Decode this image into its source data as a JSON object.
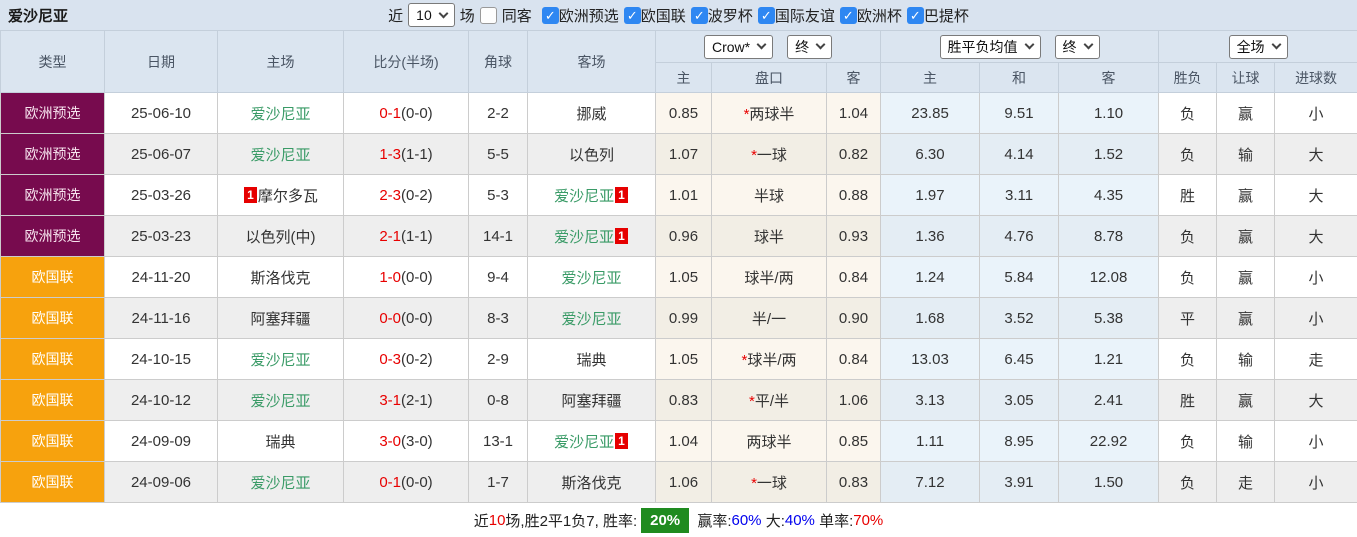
{
  "topbar": {
    "title": "爱沙尼亚",
    "near_label": "近",
    "count_value": "10",
    "games_label": "场",
    "same_visit_label": "同客",
    "same_visit_checked": false,
    "filters": [
      {
        "label": "欧洲预选",
        "checked": true
      },
      {
        "label": "欧国联",
        "checked": true
      },
      {
        "label": "波罗杯",
        "checked": true
      },
      {
        "label": "国际友谊",
        "checked": true
      },
      {
        "label": "欧洲杯",
        "checked": true
      },
      {
        "label": "巴提杯",
        "checked": true
      }
    ]
  },
  "table": {
    "main_headers": [
      "类型",
      "日期",
      "主场",
      "比分(半场)",
      "角球",
      "客场"
    ],
    "selects": {
      "asian_company": "Crow*",
      "asian_time": "终",
      "europe_type": "胜平负均值",
      "europe_time": "终",
      "scope": "全场"
    },
    "sub_headers": [
      "主",
      "盘口",
      "客",
      "主",
      "和",
      "客",
      "胜负",
      "让球",
      "进球数"
    ],
    "rows": [
      {
        "type": "欧洲预选",
        "type_color": "maroon",
        "date": "25-06-10",
        "home": "爱沙尼亚",
        "home_green": true,
        "home_badge": "",
        "score": "0-1",
        "half": "(0-0)",
        "corner": "2-2",
        "away": "挪威",
        "away_green": false,
        "away_badge": "",
        "asian": {
          "home": "0.85",
          "star": true,
          "handicap": "两球半",
          "away": "1.04"
        },
        "europe": {
          "home": "23.85",
          "draw": "9.51",
          "away": "1.10"
        },
        "results": [
          {
            "t": "负",
            "c": "green"
          },
          {
            "t": "赢",
            "c": "red"
          },
          {
            "t": "小",
            "c": "green"
          }
        ]
      },
      {
        "type": "欧洲预选",
        "type_color": "maroon",
        "date": "25-06-07",
        "home": "爱沙尼亚",
        "home_green": true,
        "home_badge": "",
        "score": "1-3",
        "half": "(1-1)",
        "corner": "5-5",
        "away": "以色列",
        "away_green": false,
        "away_badge": "",
        "asian": {
          "home": "1.07",
          "star": true,
          "handicap": "一球",
          "away": "0.82"
        },
        "europe": {
          "home": "6.30",
          "draw": "4.14",
          "away": "1.52"
        },
        "results": [
          {
            "t": "负",
            "c": "green"
          },
          {
            "t": "输",
            "c": "green"
          },
          {
            "t": "大",
            "c": "red"
          }
        ]
      },
      {
        "type": "欧洲预选",
        "type_color": "maroon",
        "date": "25-03-26",
        "home": "摩尔多瓦",
        "home_green": false,
        "home_badge": "1",
        "score": "2-3",
        "half": "(0-2)",
        "corner": "5-3",
        "away": "爱沙尼亚",
        "away_green": true,
        "away_badge": "1",
        "asian": {
          "home": "1.01",
          "star": false,
          "handicap": "半球",
          "away": "0.88"
        },
        "europe": {
          "home": "1.97",
          "draw": "3.11",
          "away": "4.35"
        },
        "results": [
          {
            "t": "胜",
            "c": "red"
          },
          {
            "t": "赢",
            "c": "red"
          },
          {
            "t": "大",
            "c": "red"
          }
        ]
      },
      {
        "type": "欧洲预选",
        "type_color": "maroon",
        "date": "25-03-23",
        "home": "以色列(中)",
        "home_green": false,
        "home_badge": "",
        "score": "2-1",
        "half": "(1-1)",
        "corner": "14-1",
        "away": "爱沙尼亚",
        "away_green": true,
        "away_badge": "1",
        "asian": {
          "home": "0.96",
          "star": false,
          "handicap": "球半",
          "away": "0.93"
        },
        "europe": {
          "home": "1.36",
          "draw": "4.76",
          "away": "8.78"
        },
        "results": [
          {
            "t": "负",
            "c": "green"
          },
          {
            "t": "赢",
            "c": "red"
          },
          {
            "t": "大",
            "c": "red"
          }
        ]
      },
      {
        "type": "欧国联",
        "type_color": "orange",
        "date": "24-11-20",
        "home": "斯洛伐克",
        "home_green": false,
        "home_badge": "",
        "score": "1-0",
        "half": "(0-0)",
        "corner": "9-4",
        "away": "爱沙尼亚",
        "away_green": true,
        "away_badge": "",
        "asian": {
          "home": "1.05",
          "star": false,
          "handicap": "球半/两",
          "away": "0.84"
        },
        "europe": {
          "home": "1.24",
          "draw": "5.84",
          "away": "12.08"
        },
        "results": [
          {
            "t": "负",
            "c": "green"
          },
          {
            "t": "赢",
            "c": "red"
          },
          {
            "t": "小",
            "c": "green"
          }
        ]
      },
      {
        "type": "欧国联",
        "type_color": "orange",
        "date": "24-11-16",
        "home": "阿塞拜疆",
        "home_green": false,
        "home_badge": "",
        "score": "0-0",
        "half": "(0-0)",
        "corner": "8-3",
        "away": "爱沙尼亚",
        "away_green": true,
        "away_badge": "",
        "asian": {
          "home": "0.99",
          "star": false,
          "handicap": "半/一",
          "away": "0.90"
        },
        "europe": {
          "home": "1.68",
          "draw": "3.52",
          "away": "5.38"
        },
        "results": [
          {
            "t": "平",
            "c": "blue"
          },
          {
            "t": "赢",
            "c": "red"
          },
          {
            "t": "小",
            "c": "green"
          }
        ]
      },
      {
        "type": "欧国联",
        "type_color": "orange",
        "date": "24-10-15",
        "home": "爱沙尼亚",
        "home_green": true,
        "home_badge": "",
        "score": "0-3",
        "half": "(0-2)",
        "corner": "2-9",
        "away": "瑞典",
        "away_green": false,
        "away_badge": "",
        "asian": {
          "home": "1.05",
          "star": true,
          "handicap": "球半/两",
          "away": "0.84"
        },
        "europe": {
          "home": "13.03",
          "draw": "6.45",
          "away": "1.21"
        },
        "results": [
          {
            "t": "负",
            "c": "green"
          },
          {
            "t": "输",
            "c": "green"
          },
          {
            "t": "走",
            "c": "blue"
          }
        ]
      },
      {
        "type": "欧国联",
        "type_color": "orange",
        "date": "24-10-12",
        "home": "爱沙尼亚",
        "home_green": true,
        "home_badge": "",
        "score": "3-1",
        "half": "(2-1)",
        "corner": "0-8",
        "away": "阿塞拜疆",
        "away_green": false,
        "away_badge": "",
        "asian": {
          "home": "0.83",
          "star": true,
          "handicap": "平/半",
          "away": "1.06"
        },
        "europe": {
          "home": "3.13",
          "draw": "3.05",
          "away": "2.41"
        },
        "results": [
          {
            "t": "胜",
            "c": "red"
          },
          {
            "t": "赢",
            "c": "red"
          },
          {
            "t": "大",
            "c": "red"
          }
        ]
      },
      {
        "type": "欧国联",
        "type_color": "orange",
        "date": "24-09-09",
        "home": "瑞典",
        "home_green": false,
        "home_badge": "",
        "score": "3-0",
        "half": "(3-0)",
        "corner": "13-1",
        "away": "爱沙尼亚",
        "away_green": true,
        "away_badge": "1",
        "asian": {
          "home": "1.04",
          "star": false,
          "handicap": "两球半",
          "away": "0.85"
        },
        "europe": {
          "home": "1.11",
          "draw": "8.95",
          "away": "22.92"
        },
        "results": [
          {
            "t": "负",
            "c": "green"
          },
          {
            "t": "输",
            "c": "green"
          },
          {
            "t": "小",
            "c": "green"
          }
        ]
      },
      {
        "type": "欧国联",
        "type_color": "orange",
        "date": "24-09-06",
        "home": "爱沙尼亚",
        "home_green": true,
        "home_badge": "",
        "score": "0-1",
        "half": "(0-0)",
        "corner": "1-7",
        "away": "斯洛伐克",
        "away_green": false,
        "away_badge": "",
        "asian": {
          "home": "1.06",
          "star": true,
          "handicap": "一球",
          "away": "0.83"
        },
        "europe": {
          "home": "7.12",
          "draw": "3.91",
          "away": "1.50"
        },
        "results": [
          {
            "t": "负",
            "c": "green"
          },
          {
            "t": "走",
            "c": "blue"
          },
          {
            "t": "小",
            "c": "green"
          }
        ]
      }
    ]
  },
  "summary": {
    "segments": [
      {
        "text": "近",
        "style": "plain"
      },
      {
        "text": "10",
        "style": "red"
      },
      {
        "text": "场,胜2平1负7, 胜率:",
        "style": "plain"
      },
      {
        "text": "20%",
        "style": "badge"
      },
      {
        "text": " 赢率:",
        "style": "plain"
      },
      {
        "text": "60%",
        "style": "blue"
      },
      {
        "text": " 大:",
        "style": "plain"
      },
      {
        "text": "40%",
        "style": "blue"
      },
      {
        "text": " 单率:",
        "style": "plain"
      },
      {
        "text": "70%",
        "style": "red"
      }
    ]
  },
  "colors": {
    "type_maroon": "#770b4e",
    "type_orange": "#f7a20d",
    "team_green": "#3a9b67",
    "score_red": "#e80000",
    "result_red": "#ee7575",
    "result_green": "#4ea14e",
    "result_blue": "#6161e8",
    "summary_badge_green": "#1f8b1f",
    "summary_blue": "#0000ee",
    "summary_red": "#e80000",
    "checkbox_blue": "#2e87f2",
    "topbar_bg": "#d9e3ef",
    "header_bg": "#dbe5f0",
    "asian_col_bg": "#fbf6ee",
    "euro_col_bg": "#eaf3fa"
  }
}
